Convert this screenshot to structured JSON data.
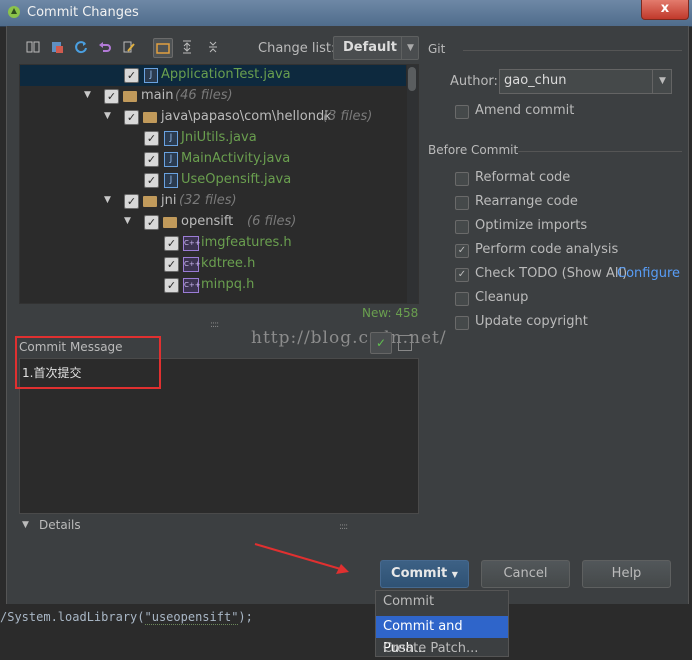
{
  "window": {
    "title": "Commit Changes",
    "close_label": "x"
  },
  "toolbar": {
    "changelist_label": "Change list:",
    "changelist_value": "Default"
  },
  "tree": {
    "rows": [
      {
        "name": "ApplicationTest.java",
        "count": ""
      },
      {
        "name": "main",
        "count": "(46 files)"
      },
      {
        "name": "java\\papaso\\com\\hellondk",
        "count": "(3 files)"
      },
      {
        "name": "JniUtils.java",
        "count": ""
      },
      {
        "name": "MainActivity.java",
        "count": ""
      },
      {
        "name": "UseOpensift.java",
        "count": ""
      },
      {
        "name": "jni",
        "count": "(32 files)"
      },
      {
        "name": "opensift",
        "count": "(6 files)"
      },
      {
        "name": "imgfeatures.h",
        "count": ""
      },
      {
        "name": "kdtree.h",
        "count": ""
      },
      {
        "name": "minpq.h",
        "count": ""
      }
    ],
    "new_count": "New: 458"
  },
  "commit": {
    "label": "Commit Message",
    "message": "1.首次提交"
  },
  "watermark": "http://blog.csdn.net/",
  "details": {
    "label": "Details"
  },
  "git": {
    "section_label": "Git",
    "author_label": "Author:",
    "author_value": "gao_chun",
    "amend_label": "Amend commit"
  },
  "before_commit": {
    "section_label": "Before Commit",
    "options": [
      {
        "label": "Reformat code",
        "checked": false
      },
      {
        "label": "Rearrange code",
        "checked": false
      },
      {
        "label": "Optimize imports",
        "checked": false
      },
      {
        "label": "Perform code analysis",
        "checked": true
      },
      {
        "label": "Check TODO (Show All)",
        "checked": true
      },
      {
        "label": "Cleanup",
        "checked": false
      },
      {
        "label": "Update copyright",
        "checked": false
      }
    ],
    "configure_link": "Configure"
  },
  "buttons": {
    "commit": "Commit",
    "cancel": "Cancel",
    "help": "Help"
  },
  "menu": {
    "items": [
      "Commit",
      "Commit and Push...",
      "Create Patch..."
    ]
  },
  "code": {
    "prefix": "/System.loadLibrary(",
    "arg": "\"useopensift\"",
    "suffix": ");"
  },
  "colors": {
    "accent_blue": "#2f65ca",
    "file_green": "#6a9f4f",
    "highlight_red": "#e03030",
    "link_blue": "#589df6"
  }
}
